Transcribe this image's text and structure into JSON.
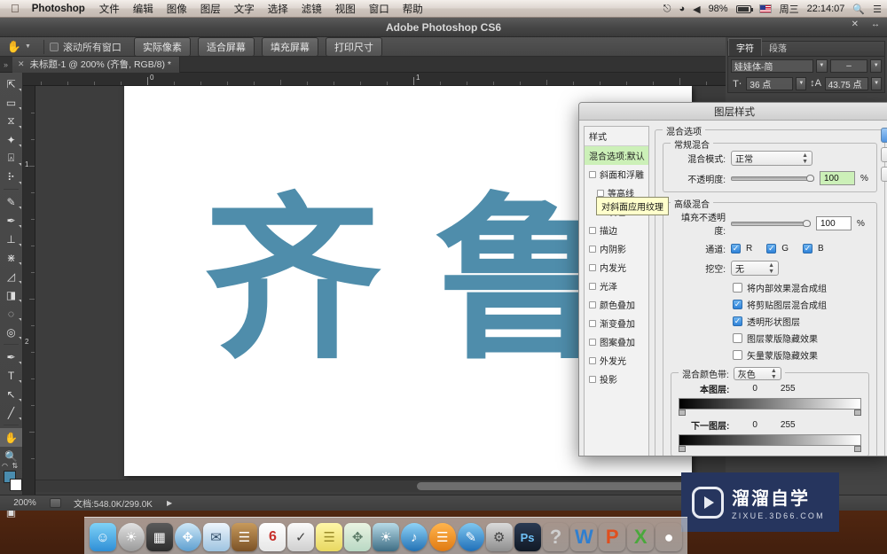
{
  "menubar": {
    "apple_icon": "apple-icon",
    "app_name": "Photoshop",
    "items": [
      "文件",
      "编辑",
      "图像",
      "图层",
      "文字",
      "选择",
      "滤镜",
      "视图",
      "窗口",
      "帮助"
    ],
    "status": {
      "bluetooth_icon": "bluetooth-icon",
      "wifi_icon": "wifi-icon",
      "volume_icon": "volume-icon",
      "battery_percent": "98%",
      "battery_icon": "battery-icon",
      "flag_icon": "us-flag-icon",
      "day": "周三",
      "time": "22:14:07",
      "search_icon": "search-icon",
      "notification_icon": "notification-center-icon"
    }
  },
  "app_window": {
    "title": "Adobe Photoshop CS6",
    "close_icon": "close-icon",
    "expand_icon": "expand-icon"
  },
  "options_bar": {
    "tool_icon": "hand-tool-icon",
    "tool_preset_arrow": "chevron-down-icon",
    "scroll_all_windows_label": "滚动所有窗口",
    "buttons": [
      "实际像素",
      "适合屏幕",
      "填充屏幕",
      "打印尺寸"
    ]
  },
  "document_tab": {
    "close_icon": "close-icon",
    "label": "未标题-1 @ 200% (齐鲁, RGB/8) *"
  },
  "toolbox": {
    "tools": [
      {
        "name": "move-tool",
        "glyph": "⊹"
      },
      {
        "name": "marquee-tool",
        "glyph": "▭"
      },
      {
        "name": "lasso-tool",
        "glyph": "𝒫"
      },
      {
        "name": "magic-wand-tool",
        "glyph": "✧"
      },
      {
        "name": "crop-tool",
        "glyph": "⌗"
      },
      {
        "name": "eyedropper-tool",
        "glyph": "⟋"
      },
      {
        "name": "healing-brush-tool",
        "glyph": "✎"
      },
      {
        "name": "brush-tool",
        "glyph": "🖌"
      },
      {
        "name": "clone-stamp-tool",
        "glyph": "⊥"
      },
      {
        "name": "history-brush-tool",
        "glyph": "⌇"
      },
      {
        "name": "eraser-tool",
        "glyph": "◣"
      },
      {
        "name": "gradient-tool",
        "glyph": "◨"
      },
      {
        "name": "blur-tool",
        "glyph": "◌"
      },
      {
        "name": "dodge-tool",
        "glyph": "◍"
      },
      {
        "name": "pen-tool",
        "glyph": "✒"
      },
      {
        "name": "type-tool",
        "glyph": "T"
      },
      {
        "name": "path-selection-tool",
        "glyph": "↖"
      },
      {
        "name": "line-shape-tool",
        "glyph": "╱"
      },
      {
        "name": "hand-tool",
        "glyph": "✋"
      },
      {
        "name": "zoom-tool",
        "glyph": "⌕"
      }
    ],
    "foreground_color": "#4a8cae",
    "background_color": "#ffffff"
  },
  "rulers": {
    "horizontal_marks": [
      "0",
      "1"
    ],
    "vertical_marks": [
      "1",
      "2"
    ]
  },
  "canvas": {
    "text": "齐鲁",
    "text_color": "#4f8dab",
    "characters": [
      "齐",
      "鲁"
    ]
  },
  "status_bar": {
    "zoom": "200%",
    "doc_info": "文档:548.0K/299.0K",
    "arrow_icon": "chevron-right-icon"
  },
  "character_panel": {
    "tabs": [
      "字符",
      "段落"
    ],
    "selected_tab": "字符",
    "font_family": "娃娃体-简",
    "font_style": "–",
    "size_icon": "font-size-icon",
    "font_size": "36 点",
    "leading_icon": "leading-icon",
    "leading": "43.75 点"
  },
  "dialog": {
    "title": "图层样式",
    "styles_header": "样式",
    "styles": [
      {
        "label": "混合选项:默认",
        "selected": true,
        "checkbox": false,
        "indent": false
      },
      {
        "label": "斜面和浮雕",
        "selected": false,
        "checkbox": true,
        "indent": false
      },
      {
        "label": "等高线",
        "selected": false,
        "checkbox": true,
        "indent": true
      },
      {
        "label": "纹理",
        "selected": false,
        "checkbox": true,
        "indent": true
      },
      {
        "label": "描边",
        "selected": false,
        "checkbox": true,
        "indent": false
      },
      {
        "label": "内阴影",
        "selected": false,
        "checkbox": true,
        "indent": false
      },
      {
        "label": "内发光",
        "selected": false,
        "checkbox": true,
        "indent": false
      },
      {
        "label": "光泽",
        "selected": false,
        "checkbox": true,
        "indent": false
      },
      {
        "label": "颜色叠加",
        "selected": false,
        "checkbox": true,
        "indent": false
      },
      {
        "label": "渐变叠加",
        "selected": false,
        "checkbox": true,
        "indent": false
      },
      {
        "label": "图案叠加",
        "selected": false,
        "checkbox": true,
        "indent": false
      },
      {
        "label": "外发光",
        "selected": false,
        "checkbox": true,
        "indent": false
      },
      {
        "label": "投影",
        "selected": false,
        "checkbox": true,
        "indent": false
      }
    ],
    "tooltip": "对斜面应用纹理",
    "blend_options_legend": "混合选项",
    "general_blending": {
      "legend": "常规混合",
      "blend_mode_label": "混合模式:",
      "blend_mode_value": "正常",
      "opacity_label": "不透明度:",
      "opacity_value": "100",
      "percent": "%"
    },
    "advanced_blending": {
      "legend": "高级混合",
      "fill_opacity_label": "填充不透明度:",
      "fill_opacity_value": "100",
      "percent": "%",
      "channels_label": "通道:",
      "channels": [
        {
          "label": "R",
          "checked": true
        },
        {
          "label": "G",
          "checked": true
        },
        {
          "label": "B",
          "checked": true
        }
      ],
      "knockout_label": "挖空:",
      "knockout_value": "无",
      "checkboxes": [
        {
          "label": "将内部效果混合成组",
          "checked": false
        },
        {
          "label": "将剪贴图层混合成组",
          "checked": true
        },
        {
          "label": "透明形状图层",
          "checked": true
        },
        {
          "label": "图层蒙版隐藏效果",
          "checked": false
        },
        {
          "label": "矢量蒙版隐藏效果",
          "checked": false
        }
      ]
    },
    "blend_if": {
      "legend": "混合颜色带:",
      "channel_value": "灰色",
      "this_layer_label": "本图层:",
      "this_layer_min": "0",
      "this_layer_max": "255",
      "underlying_label": "下一图层:",
      "underlying_min": "0",
      "underlying_max": "255"
    }
  },
  "watermark": {
    "brand": "溜溜自学",
    "url": "ZIXUE.3D66.COM",
    "play_icon": "play-logo-icon",
    "background": "#26355e"
  },
  "dock": {
    "items": [
      {
        "name": "finder",
        "glyph": "🙂",
        "color": "linear-gradient(180deg,#7fd2f7,#2f8fd6)"
      },
      {
        "name": "launchpad",
        "glyph": "🚀",
        "color": "linear-gradient(180deg,#d8d8d8,#9a9a9a)",
        "circle": true
      },
      {
        "name": "mission-control",
        "glyph": "▦",
        "color": "linear-gradient(180deg,#5a5a5a,#2e2e2e)"
      },
      {
        "name": "safari",
        "glyph": "🧭",
        "color": "linear-gradient(180deg,#cfe8f7,#6fa8d6)",
        "circle": true
      },
      {
        "name": "mail",
        "glyph": "✉",
        "color": "linear-gradient(180deg,#e8f2fb,#9dc3e0)"
      },
      {
        "name": "contacts",
        "glyph": "📒",
        "color": "linear-gradient(180deg,#c79a5c,#7b5227)"
      },
      {
        "name": "calendar",
        "glyph": "6",
        "color": "linear-gradient(180deg,#ffffff,#e6e6e6)"
      },
      {
        "name": "reminders",
        "glyph": "✓",
        "color": "linear-gradient(180deg,#fafafa,#cfcfcf)"
      },
      {
        "name": "notes",
        "glyph": "▤",
        "color": "linear-gradient(180deg,#fff7a8,#e8d861)"
      },
      {
        "name": "maps",
        "glyph": "🧭",
        "color": "linear-gradient(180deg,#e8f4e0,#b9d8c4)"
      },
      {
        "name": "photos",
        "glyph": "🌴",
        "color": "linear-gradient(180deg,#b8dbe8,#4d7d94)"
      },
      {
        "name": "itunes",
        "glyph": "♪",
        "color": "linear-gradient(180deg,#8fd3f7,#2b7fc4)",
        "circle": true
      },
      {
        "name": "ibooks",
        "glyph": "📖",
        "color": "linear-gradient(180deg,#ffb44d,#e07a12)",
        "circle": true
      },
      {
        "name": "app-store",
        "glyph": "A",
        "color": "linear-gradient(180deg,#7fc7f0,#2273bb)",
        "circle": true
      },
      {
        "name": "system-preferences",
        "glyph": "⚙",
        "color": "linear-gradient(180deg,#d5d5d5,#8e8e8e)"
      },
      {
        "name": "photoshop",
        "glyph": "Ps",
        "color": "linear-gradient(180deg,#2a3a52,#16202e)"
      },
      {
        "name": "help-viewer",
        "glyph": "?",
        "color": "transparent"
      },
      {
        "name": "wps-writer",
        "glyph": "W",
        "color": "transparent"
      },
      {
        "name": "wps-presentation",
        "glyph": "P",
        "color": "transparent"
      },
      {
        "name": "wps-spreadsheet",
        "glyph": "X",
        "color": "transparent"
      },
      {
        "name": "penguin-app",
        "glyph": "🐧",
        "color": "transparent"
      }
    ]
  }
}
